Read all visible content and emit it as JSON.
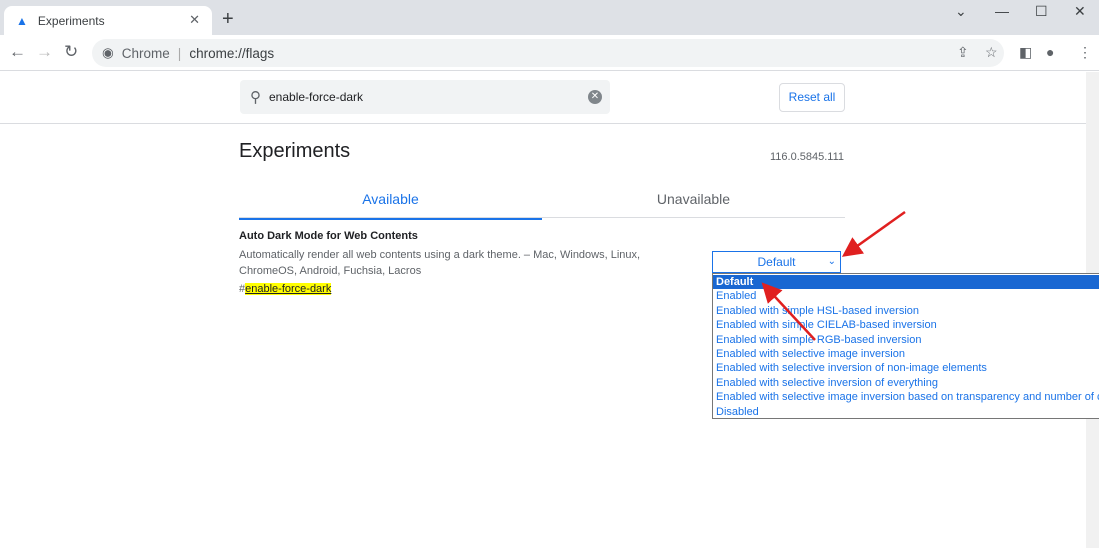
{
  "browser": {
    "tab_title": "Experiments",
    "omnibox_site": "Chrome",
    "omnibox_url": "chrome://flags"
  },
  "search": {
    "value": "enable-force-dark"
  },
  "reset_label": "Reset all",
  "page_title": "Experiments",
  "version": "116.0.5845.111",
  "tabs": [
    {
      "label": "Available",
      "active": true
    },
    {
      "label": "Unavailable",
      "active": false
    }
  ],
  "flag": {
    "title": "Auto Dark Mode for Web Contents",
    "description": "Automatically render all web contents using a dark theme. – Mac, Windows, Linux, ChromeOS, Android, Fuchsia, Lacros",
    "hash": "#",
    "link": "enable-force-dark",
    "selected": "Default",
    "options": [
      "Default",
      "Enabled",
      "Enabled with simple HSL-based inversion",
      "Enabled with simple CIELAB-based inversion",
      "Enabled with simple RGB-based inversion",
      "Enabled with selective image inversion",
      "Enabled with selective inversion of non-image elements",
      "Enabled with selective inversion of everything",
      "Enabled with selective image inversion based on transparency and number of colors",
      "Disabled"
    ]
  },
  "colors": {
    "accent": "#1a73e8",
    "highlight": "#ffff00",
    "annotation_arrow": "#e02020"
  }
}
